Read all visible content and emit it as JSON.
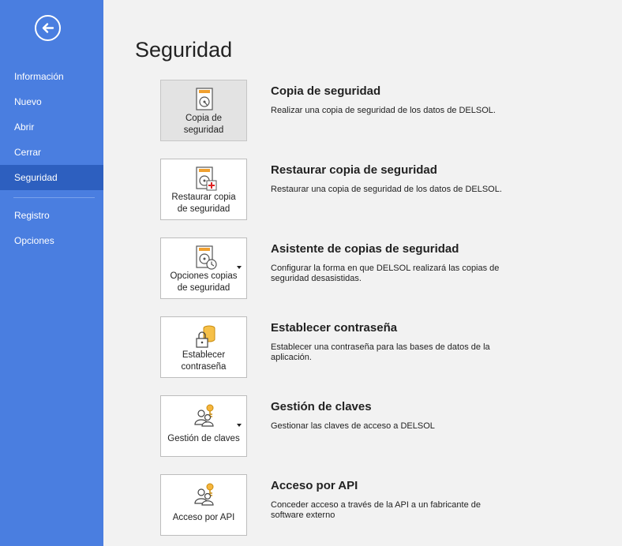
{
  "sidebar": {
    "back_icon": "back-arrow-circle-icon",
    "items": [
      {
        "label": "Información"
      },
      {
        "label": "Nuevo"
      },
      {
        "label": "Abrir"
      },
      {
        "label": "Cerrar"
      },
      {
        "label": "Seguridad",
        "active": true
      },
      {
        "label": "Registro"
      },
      {
        "label": "Opciones"
      }
    ]
  },
  "page": {
    "title": "Seguridad"
  },
  "actions": [
    {
      "tile_label": "Copia de\nseguridad",
      "title": "Copia de seguridad",
      "description": "Realizar una copia de seguridad de los datos de DELSOL.",
      "icon": "disk-backup-icon"
    },
    {
      "tile_label": "Restaurar copia\nde seguridad",
      "title": "Restaurar copia de seguridad",
      "description": "Restaurar una copia de seguridad de los datos de DELSOL.",
      "icon": "disk-restore-icon"
    },
    {
      "tile_label": "Opciones copias\nde seguridad",
      "title": "Asistente de copias de seguridad",
      "description": "Configurar la forma en que DELSOL realizará las copias de seguridad desasistidas.",
      "icon": "disk-schedule-icon"
    },
    {
      "tile_label": "Establecer\ncontraseña",
      "title": "Establecer contraseña",
      "description": "Establecer una contraseña para las bases de datos de la aplicación.",
      "icon": "lock-database-icon"
    },
    {
      "tile_label": "Gestión de claves",
      "title": "Gestión de claves",
      "description": "Gestionar las claves de acceso a DELSOL",
      "icon": "users-key-icon"
    },
    {
      "tile_label": "Acceso por API",
      "title": "Acceso por API",
      "description": "Conceder acceso a través de la API a un fabricante de software externo",
      "icon": "users-key-icon"
    }
  ],
  "colors": {
    "sidebar": "#4a7ee0",
    "sidebar_active": "#2d5fbf",
    "background": "#f2f2f2"
  }
}
